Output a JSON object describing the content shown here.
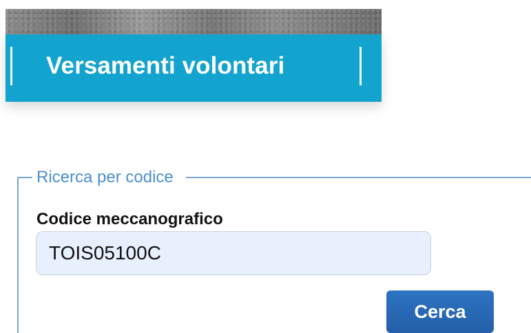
{
  "header": {
    "title": "Versamenti volontari"
  },
  "search": {
    "section_title": "Ricerca per codice",
    "field_label": "Codice meccanografico",
    "field_value": "TOIS05100C",
    "button_label": "Cerca"
  },
  "colors": {
    "header_background": "#13a3cf",
    "legend_text": "#4d8fd0",
    "input_background": "#e8f0fe",
    "button_background": "#2d73c1"
  },
  "icons": {
    "header_dividers": "vertical-divider"
  }
}
